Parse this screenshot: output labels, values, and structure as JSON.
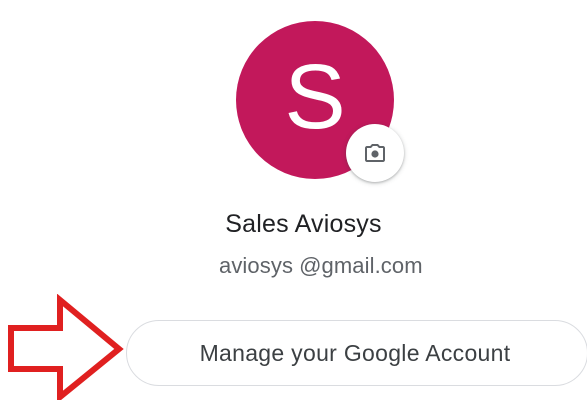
{
  "account": {
    "avatar_initial": "S",
    "avatar_color": "#c2185b",
    "camera_icon": "camera-icon",
    "name": "Sales Aviosys",
    "email_user": "aviosys",
    "email_domain": "@gmail.com",
    "manage_label": "Manage your Google Account"
  },
  "annotation": {
    "arrow_icon": "arrow-right-outline-icon",
    "arrow_color": "#e02020"
  }
}
